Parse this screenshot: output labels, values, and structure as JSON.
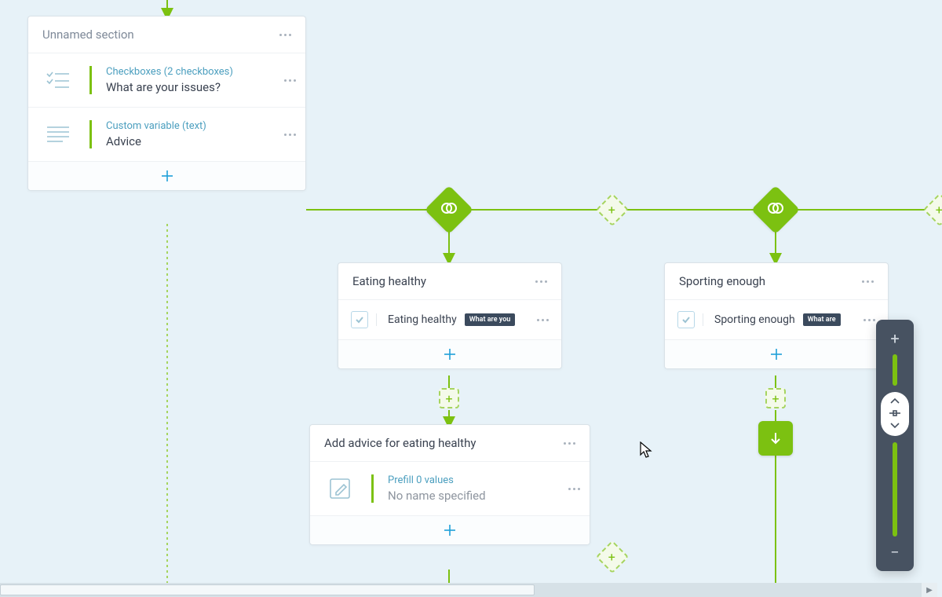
{
  "section_card": {
    "title": "Unnamed section",
    "items": [
      {
        "type_label": "Checkboxes (2 checkboxes)",
        "title": "What are your issues?"
      },
      {
        "type_label": "Custom variable (text)",
        "title": "Advice"
      }
    ]
  },
  "branch_a": {
    "title": "Eating healthy",
    "item_label": "Eating healthy",
    "pill": "What are you"
  },
  "branch_b": {
    "title": "Sporting enough",
    "item_label": "Sporting enough",
    "pill": "What are"
  },
  "advice_card": {
    "title": "Add advice for eating healthy",
    "prefill_label": "Prefill 0 values",
    "name_label": "No name specified"
  },
  "colors": {
    "green": "#7cc111",
    "blue": "#1ea0d8"
  }
}
